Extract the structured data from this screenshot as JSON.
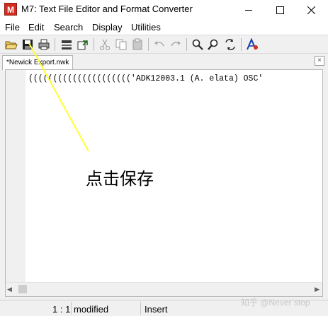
{
  "window": {
    "title": "M7: Text File Editor and Format Converter",
    "app_icon_letter": "M"
  },
  "menu": [
    "File",
    "Edit",
    "Search",
    "Display",
    "Utilities"
  ],
  "toolbar": {
    "buttons": [
      "open-file-icon",
      "save-icon",
      "print-icon",
      "convert-format-icon",
      "export-icon",
      "cut-icon",
      "copy-icon",
      "paste-icon",
      "undo-icon",
      "redo-icon",
      "find-icon",
      "find-next-icon",
      "replace-icon",
      "mega-icon"
    ]
  },
  "tab": {
    "label": "*Newick Export.nwk",
    "close_glyph": "×"
  },
  "editor": {
    "content": "((((((((((((((((((((('ADK12003.1 (A. elata) OSC'"
  },
  "status": {
    "position": "1 : 1",
    "state": "modified",
    "mode": "Insert"
  },
  "annotation": {
    "text": "点击保存",
    "line_color": "#ffff33"
  },
  "watermark": "知乎 @Never stop"
}
